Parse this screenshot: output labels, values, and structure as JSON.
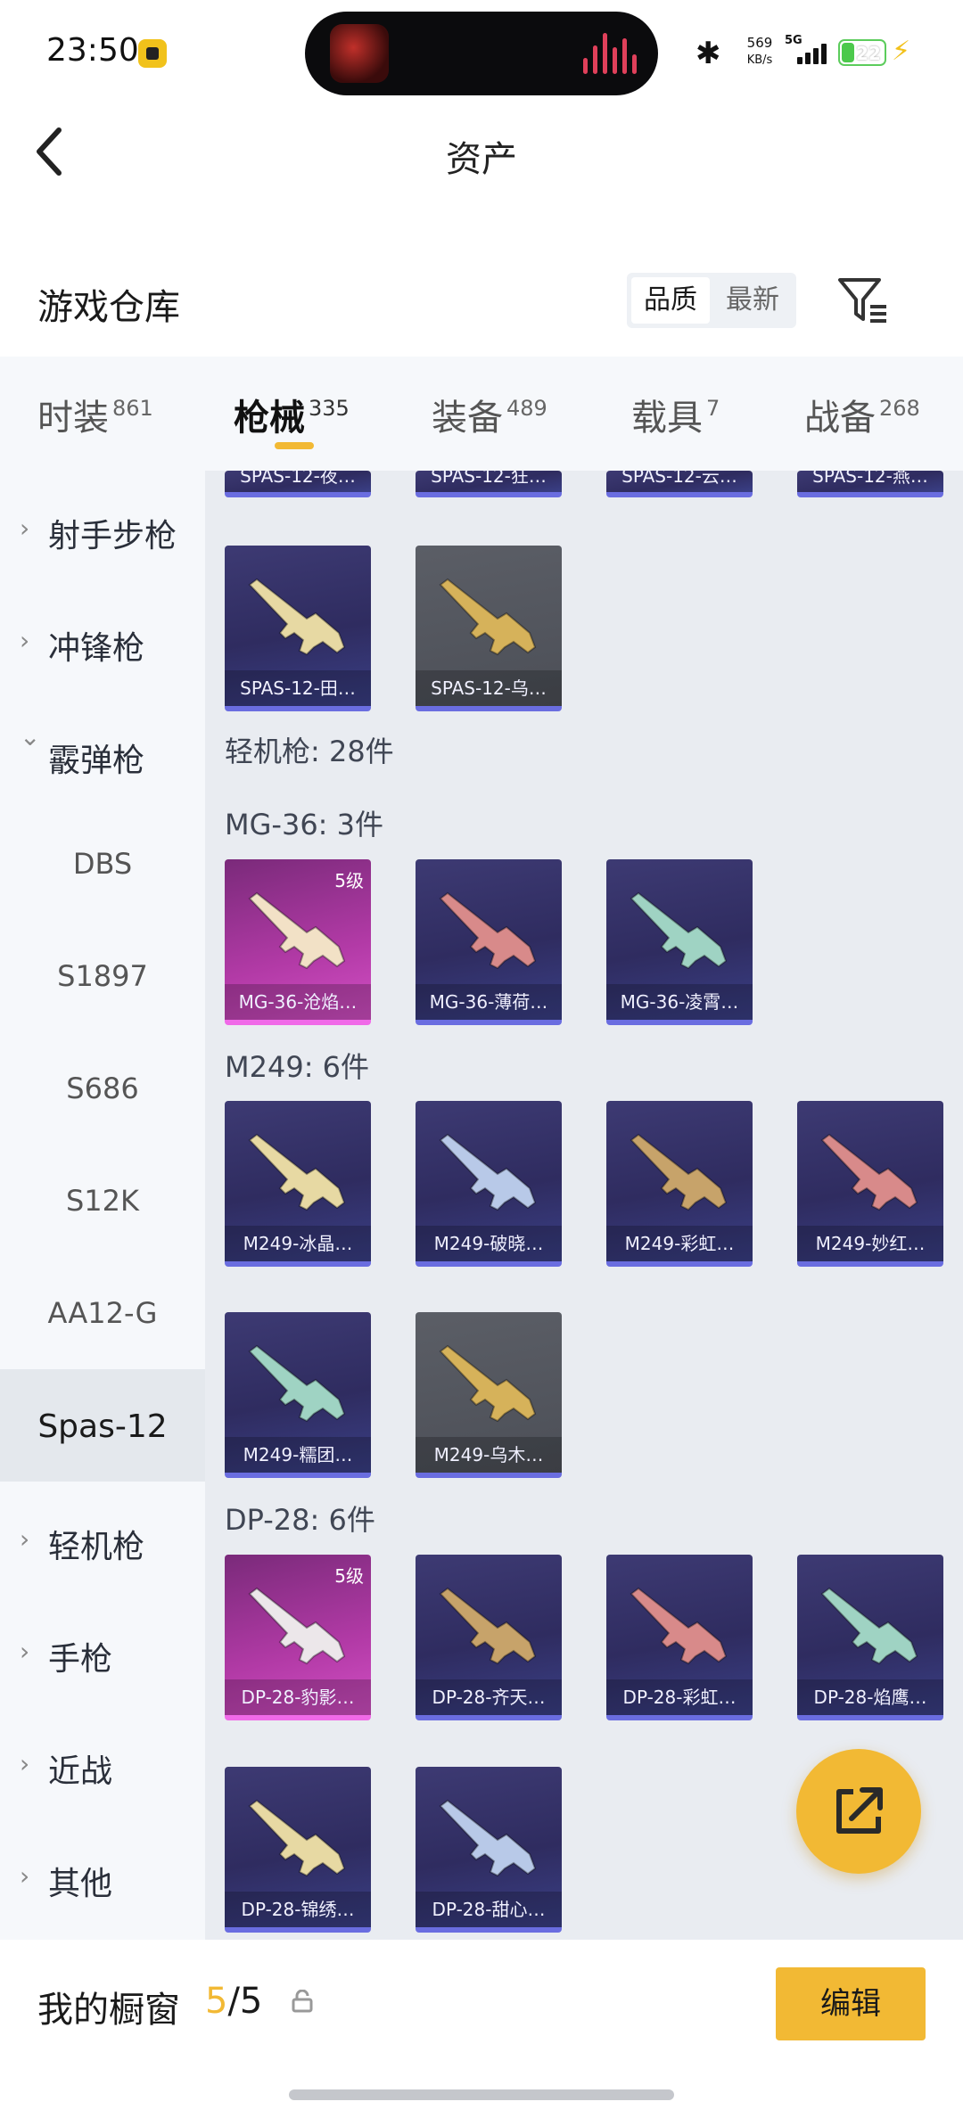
{
  "status_bar": {
    "time": "23:50",
    "net_speed": "569",
    "net_unit": "KB/s",
    "signal": "5G",
    "battery": "22"
  },
  "header": {
    "title": "资产",
    "back_icon": "chevron-left-icon"
  },
  "warehouse": {
    "title": "游戏仓库",
    "sort_options": [
      "品质",
      "最新"
    ],
    "selected_sort": "品质",
    "filter_icon": "filter-icon"
  },
  "tabs": [
    {
      "label": "时装",
      "count": "861"
    },
    {
      "label": "枪械",
      "count": "335",
      "active": true
    },
    {
      "label": "装备",
      "count": "489"
    },
    {
      "label": "载具",
      "count": "7"
    },
    {
      "label": "战备",
      "count": "268"
    }
  ],
  "sidebar": [
    {
      "label": "射手步枪",
      "type": "collapsed"
    },
    {
      "label": "冲锋枪",
      "type": "collapsed"
    },
    {
      "label": "霰弹枪",
      "type": "expanded"
    },
    {
      "label": "DBS",
      "type": "sub"
    },
    {
      "label": "S1897",
      "type": "sub"
    },
    {
      "label": "S686",
      "type": "sub"
    },
    {
      "label": "S12K",
      "type": "sub"
    },
    {
      "label": "AA12-G",
      "type": "sub"
    },
    {
      "label": "Spas-12",
      "type": "sub",
      "selected": true
    },
    {
      "label": "轻机枪",
      "type": "collapsed"
    },
    {
      "label": "手枪",
      "type": "collapsed"
    },
    {
      "label": "近战",
      "type": "collapsed"
    },
    {
      "label": "其他",
      "type": "collapsed"
    }
  ],
  "content": {
    "partial_row": [
      "SPAS-12-夜…",
      "SPAS-12-狂…",
      "SPAS-12-云…",
      "SPAS-12-燕…"
    ],
    "spas_row": [
      {
        "name": "SPAS-12-田…",
        "color": "purple"
      },
      {
        "name": "SPAS-12-乌…",
        "color": "gray"
      }
    ],
    "lmg_summary": "轻机枪: 28件",
    "groups": [
      {
        "title": "MG-36: 3件",
        "items": [
          {
            "name": "MG-36-沧焰…",
            "color": "pink",
            "level": "5级"
          },
          {
            "name": "MG-36-薄荷…",
            "color": "purple"
          },
          {
            "name": "MG-36-凌霄…",
            "color": "purple"
          }
        ]
      },
      {
        "title": "M249: 6件",
        "items": [
          {
            "name": "M249-冰晶…",
            "color": "purple"
          },
          {
            "name": "M249-破晓…",
            "color": "purple"
          },
          {
            "name": "M249-彩虹…",
            "color": "purple"
          },
          {
            "name": "M249-妙红…",
            "color": "purple"
          },
          {
            "name": "M249-糯团…",
            "color": "purple"
          },
          {
            "name": "M249-乌木…",
            "color": "gray"
          }
        ]
      },
      {
        "title": "DP-28: 6件",
        "items": [
          {
            "name": "DP-28-豹影…",
            "color": "pink",
            "level": "5级"
          },
          {
            "name": "DP-28-齐天…",
            "color": "purple"
          },
          {
            "name": "DP-28-彩虹…",
            "color": "purple"
          },
          {
            "name": "DP-28-焰鹰…",
            "color": "purple"
          },
          {
            "name": "DP-28-锦绣…",
            "color": "purple"
          },
          {
            "name": "DP-28-甜心…",
            "color": "purple"
          }
        ]
      }
    ]
  },
  "fab": {
    "icon": "share-out-icon"
  },
  "bottom": {
    "title": "我的橱窗",
    "count_current": "5",
    "count_total": "/5",
    "lock_icon": "lock-icon",
    "edit_label": "编辑"
  }
}
